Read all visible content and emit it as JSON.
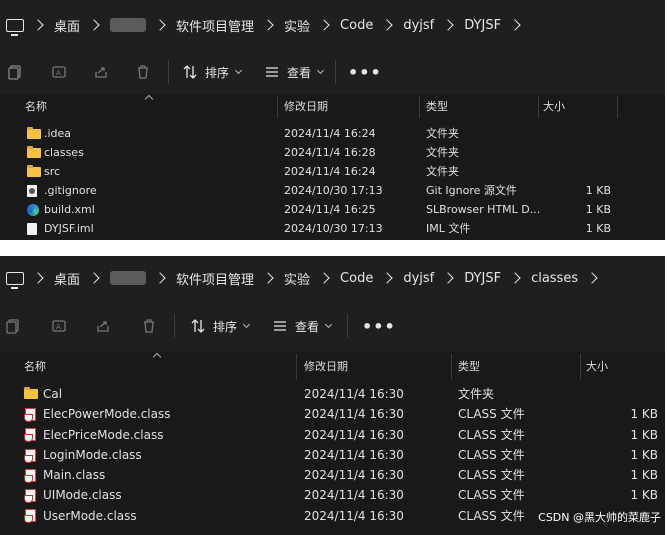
{
  "windows": [
    {
      "breadcrumb": [
        "桌面",
        "",
        "软件项目管理",
        "实验",
        "Code",
        "dyjsf",
        "DYJSF"
      ],
      "toolbar": {
        "sort_label": "排序",
        "view_label": "查看",
        "more": "•••"
      },
      "columns": {
        "name": "名称",
        "modified": "修改日期",
        "type": "类型",
        "size": "大小"
      },
      "rows": [
        {
          "icon": "folder-icon",
          "name": ".idea",
          "modified": "2024/11/4 16:24",
          "type": "文件夹",
          "size": ""
        },
        {
          "icon": "folder-icon",
          "name": "classes",
          "modified": "2024/11/4 16:28",
          "type": "文件夹",
          "size": ""
        },
        {
          "icon": "folder-icon",
          "name": "src",
          "modified": "2024/11/4 16:24",
          "type": "文件夹",
          "size": ""
        },
        {
          "icon": "gitignore-file-icon",
          "name": ".gitignore",
          "modified": "2024/10/30 17:13",
          "type": "Git Ignore 源文件",
          "size": "1 KB"
        },
        {
          "icon": "slbrowser-file-icon",
          "name": "build.xml",
          "modified": "2024/11/4 16:25",
          "type": "SLBrowser HTML D...",
          "size": "1 KB"
        },
        {
          "icon": "file-icon",
          "name": "DYJSF.iml",
          "modified": "2024/10/30 17:13",
          "type": "IML 文件",
          "size": "1 KB"
        }
      ]
    },
    {
      "breadcrumb": [
        "桌面",
        "",
        "软件项目管理",
        "实验",
        "Code",
        "dyjsf",
        "DYJSF",
        "classes"
      ],
      "toolbar": {
        "sort_label": "排序",
        "view_label": "查看",
        "more": "•••"
      },
      "columns": {
        "name": "名称",
        "modified": "修改日期",
        "type": "类型",
        "size": "大小"
      },
      "rows": [
        {
          "icon": "folder-icon",
          "name": "Cal",
          "modified": "2024/11/4 16:30",
          "type": "文件夹",
          "size": ""
        },
        {
          "icon": "java-class-icon",
          "name": "ElecPowerMode.class",
          "modified": "2024/11/4 16:30",
          "type": "CLASS 文件",
          "size": "1 KB"
        },
        {
          "icon": "java-class-icon",
          "name": "ElecPriceMode.class",
          "modified": "2024/11/4 16:30",
          "type": "CLASS 文件",
          "size": "1 KB"
        },
        {
          "icon": "java-class-icon",
          "name": "LoginMode.class",
          "modified": "2024/11/4 16:30",
          "type": "CLASS 文件",
          "size": "1 KB"
        },
        {
          "icon": "java-class-icon",
          "name": "Main.class",
          "modified": "2024/11/4 16:30",
          "type": "CLASS 文件",
          "size": "1 KB"
        },
        {
          "icon": "java-class-icon",
          "name": "UIMode.class",
          "modified": "2024/11/4 16:30",
          "type": "CLASS 文件",
          "size": "1 KB"
        },
        {
          "icon": "java-class-icon",
          "name": "UserMode.class",
          "modified": "2024/11/4 16:30",
          "type": "CLASS 文件",
          "size": ""
        }
      ]
    }
  ],
  "watermark": "CSDN @黑大帅的菜鹿子",
  "colors": {
    "background": "#1c1c1c",
    "folder": "#f5c242",
    "text": "#e6e6e6"
  }
}
